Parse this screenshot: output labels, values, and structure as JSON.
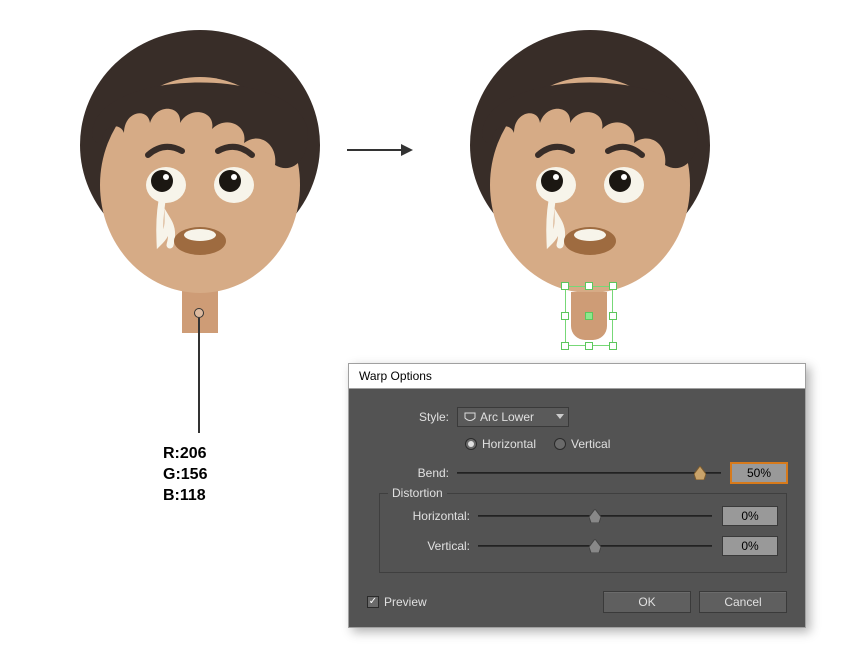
{
  "rgb": {
    "r": "R:206",
    "g": "G:156",
    "b": "B:118"
  },
  "dialog": {
    "title": "Warp Options",
    "style_label": "Style:",
    "style_value": "Arc Lower",
    "orientation": {
      "horizontal": "Horizontal",
      "vertical": "Vertical",
      "selected": "horizontal"
    },
    "bend": {
      "label": "Bend:",
      "value": "50%",
      "pos": 0.92
    },
    "distortion": {
      "legend": "Distortion",
      "horizontal": {
        "label": "Horizontal:",
        "value": "0%",
        "pos": 0.5
      },
      "vertical": {
        "label": "Vertical:",
        "value": "0%",
        "pos": 0.5
      }
    },
    "preview": {
      "label": "Preview",
      "checked": true
    },
    "ok": "OK",
    "cancel": "Cancel"
  },
  "colors": {
    "skin": "#d6ab86",
    "neck": "#ce9c76",
    "hair": "#382d28",
    "mouth": "#9e6b40",
    "white": "#f7f4ea"
  }
}
